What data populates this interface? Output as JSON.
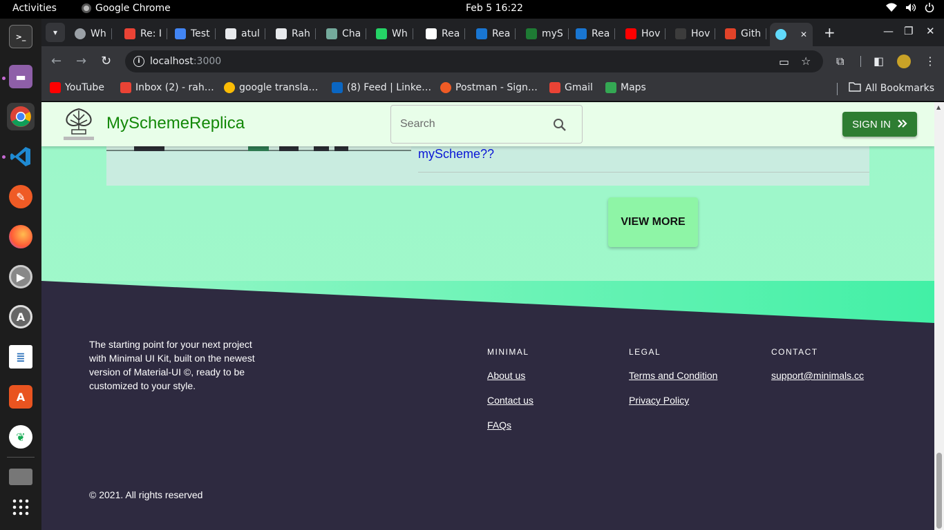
{
  "desktop": {
    "activities": "Activities",
    "app_name": "Google Chrome",
    "clock": "Feb 5  16:22"
  },
  "dock": {
    "items": [
      "terminal-icon",
      "files-icon",
      "chrome-icon",
      "vscode-icon",
      "postman-icon",
      "firefox-icon",
      "settings-icon",
      "software-updater-icon",
      "libreoffice-writer-icon",
      "app-center-icon",
      "mongodb-compass-icon",
      "disk-icon",
      "show-apps-icon"
    ]
  },
  "browser": {
    "tabs": [
      {
        "label": "Wh",
        "icon": "chrome-icon"
      },
      {
        "label": "Re: I",
        "icon": "gmail-icon"
      },
      {
        "label": "Test",
        "icon": "docs-icon"
      },
      {
        "label": "atul",
        "icon": "github-icon"
      },
      {
        "label": "Rah",
        "icon": "github-icon"
      },
      {
        "label": "Cha",
        "icon": "chatgpt-icon"
      },
      {
        "label": "Wh",
        "icon": "whatsapp-icon"
      },
      {
        "label": "Rea",
        "icon": "fs-icon"
      },
      {
        "label": "Rea",
        "icon": "mui-icon"
      },
      {
        "label": "myS",
        "icon": "myscheme-icon"
      },
      {
        "label": "Rea",
        "icon": "mui-icon"
      },
      {
        "label": "Hov",
        "icon": "youtube-icon"
      },
      {
        "label": "Hov",
        "icon": "em-icon"
      },
      {
        "label": "Gith",
        "icon": "git-icon"
      },
      {
        "label": "",
        "icon": "react-icon",
        "active": true
      }
    ],
    "url_host": "localhost",
    "url_port": ":3000",
    "bookmarks": [
      {
        "label": "YouTube",
        "icon": "youtube-icon"
      },
      {
        "label": "Inbox (2) - rah…",
        "icon": "gmail-icon"
      },
      {
        "label": "google transla…",
        "icon": "google-icon"
      },
      {
        "label": "(8) Feed | Linke…",
        "icon": "linkedin-icon"
      },
      {
        "label": "Postman - Sign…",
        "icon": "postman-icon"
      },
      {
        "label": "Gmail",
        "icon": "gmail-icon"
      },
      {
        "label": "Maps",
        "icon": "maps-icon"
      }
    ],
    "all_bookmarks": "All Bookmarks"
  },
  "header": {
    "brand": "MySchemeReplica",
    "search_placeholder": "Search",
    "signin_label": "SIGN IN"
  },
  "content": {
    "faq_text": "myScheme??",
    "view_more_label": "VIEW MORE"
  },
  "footer": {
    "about": "The starting point for your next project with Minimal UI Kit, built on the newest version of Material-UI ©, ready to be customized to your style.",
    "columns": [
      {
        "heading": "MINIMAL",
        "links": [
          "About us",
          "Contact us",
          "FAQs"
        ]
      },
      {
        "heading": "LEGAL",
        "links": [
          "Terms and Condition",
          "Privacy Policy"
        ]
      },
      {
        "heading": "CONTACT",
        "links": [
          "support@minimals.cc"
        ]
      }
    ],
    "copyright": "© 2021. All rights reserved"
  },
  "colors": {
    "brand_green": "#138808",
    "signin_bg": "#2e7d32",
    "page_bg": "#9cf7c9",
    "footer_bg": "#2e2a40",
    "link_blue": "#0a16d6"
  }
}
